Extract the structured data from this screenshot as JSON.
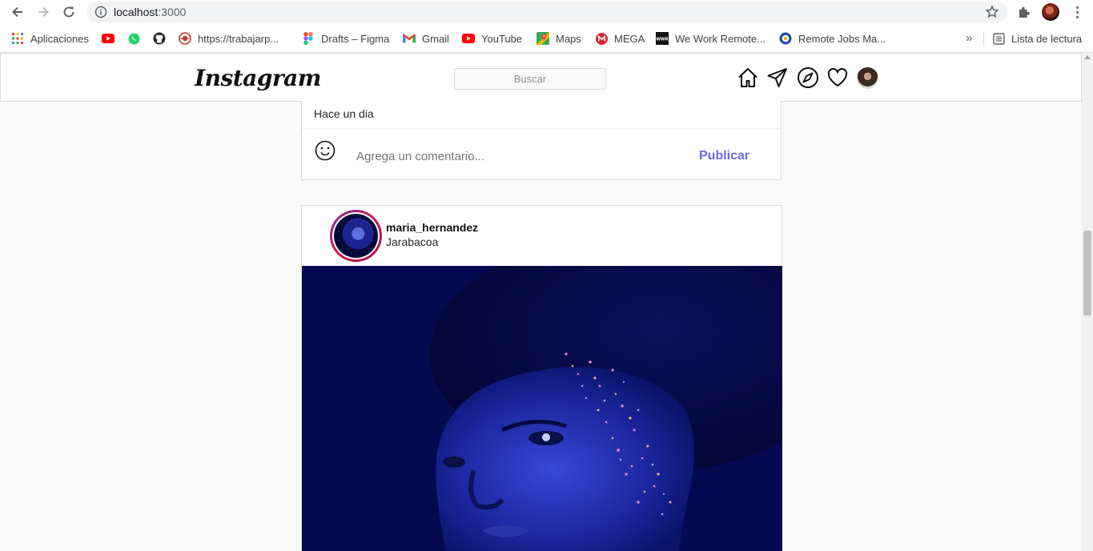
{
  "browser": {
    "url_host": "localhost",
    "url_port": ":3000",
    "bookmarks": [
      {
        "label": "Aplicaciones",
        "icon": "apps-grid-icon"
      },
      {
        "label": "",
        "icon": "youtube-icon"
      },
      {
        "label": "",
        "icon": "whatsapp-icon"
      },
      {
        "label": "",
        "icon": "github-icon"
      },
      {
        "label": "https://trabajarp...",
        "icon": "globe-icon"
      },
      {
        "label": "Drafts – Figma",
        "icon": "figma-icon"
      },
      {
        "label": "Gmail",
        "icon": "gmail-icon"
      },
      {
        "label": "YouTube",
        "icon": "youtube-icon"
      },
      {
        "label": "Maps",
        "icon": "maps-icon"
      },
      {
        "label": "MEGA",
        "icon": "mega-icon"
      },
      {
        "label": "We Work Remote...",
        "icon": "weworkremotely-icon"
      },
      {
        "label": "Remote Jobs Ma...",
        "icon": "remote-jobs-icon"
      }
    ],
    "more_bookmarks": "»",
    "reading_list": "Lista de lectura"
  },
  "instagram": {
    "logo": "Instagram",
    "search_placeholder": "Buscar",
    "nav_icons": [
      "home-icon",
      "direct-message-icon",
      "explore-icon",
      "activity-heart-icon",
      "profile-avatar"
    ]
  },
  "previous_post": {
    "time_ago": "Hace un dia",
    "comment_placeholder": "Agrega un comentario...",
    "publish_label": "Publicar"
  },
  "post": {
    "username": "maria_hernandez",
    "location": "Jarabacoa"
  },
  "colors": {
    "accent_blue": "#6a6ce8",
    "border": "#dbdbdb",
    "background": "#fafafa",
    "story_ring_start": "#7a2a9a",
    "story_ring_end": "#d4154a",
    "post_image_bg": "#050a52"
  }
}
